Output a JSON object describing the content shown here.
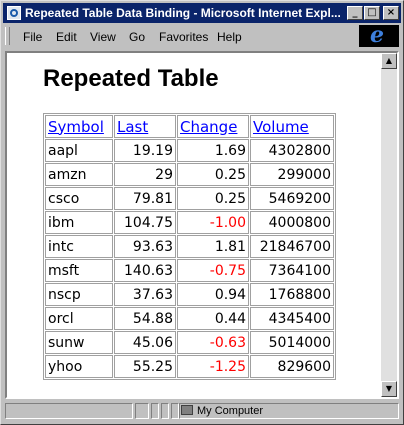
{
  "window": {
    "title": "Repeated Table Data Binding - Microsoft Internet Expl..."
  },
  "menu": [
    "File",
    "Edit",
    "View",
    "Go",
    "Favorites",
    "Help"
  ],
  "page": {
    "heading": "Repeated Table"
  },
  "table": {
    "headers": [
      "Symbol",
      "Last",
      "Change",
      "Volume"
    ],
    "rows": [
      {
        "symbol": "aapl",
        "last": "19.19",
        "change": "1.69",
        "volume": "4302800"
      },
      {
        "symbol": "amzn",
        "last": "29",
        "change": "0.25",
        "volume": "299000"
      },
      {
        "symbol": "csco",
        "last": "79.81",
        "change": "0.25",
        "volume": "5469200"
      },
      {
        "symbol": "ibm",
        "last": "104.75",
        "change": "-1.00",
        "volume": "4000800"
      },
      {
        "symbol": "intc",
        "last": "93.63",
        "change": "1.81",
        "volume": "21846700"
      },
      {
        "symbol": "msft",
        "last": "140.63",
        "change": "-0.75",
        "volume": "7364100"
      },
      {
        "symbol": "nscp",
        "last": "37.63",
        "change": "0.94",
        "volume": "1768800"
      },
      {
        "symbol": "orcl",
        "last": "54.88",
        "change": "0.44",
        "volume": "4345400"
      },
      {
        "symbol": "sunw",
        "last": "45.06",
        "change": "-0.63",
        "volume": "5014000"
      },
      {
        "symbol": "yhoo",
        "last": "55.25",
        "change": "-1.25",
        "volume": "829600"
      }
    ],
    "negative_color": "#ff0000",
    "link_color": "#0000ff"
  },
  "status": {
    "zone": "My Computer"
  },
  "colors": {
    "titlebar": "#0a246a",
    "chrome": "#c0c0c0"
  }
}
